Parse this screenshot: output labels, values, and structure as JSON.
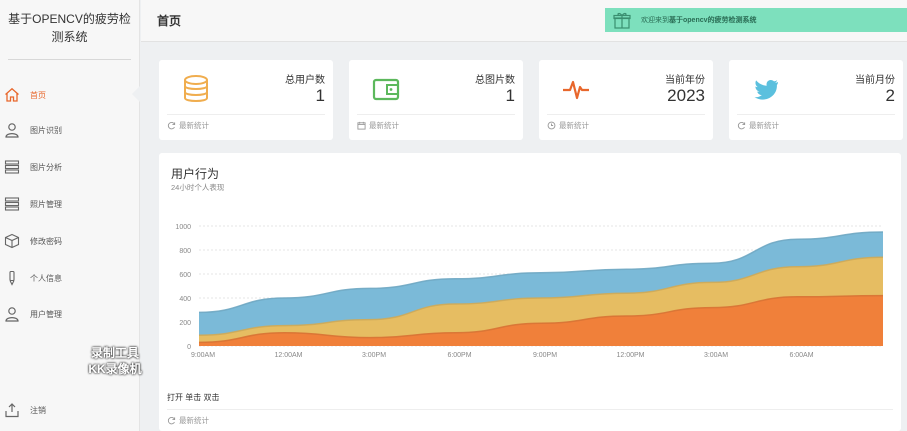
{
  "sidebar": {
    "brand": "基于OPENCV的疲劳检测系统",
    "items": [
      {
        "label": "首页",
        "icon": "home-icon",
        "active": true
      },
      {
        "label": "图片识别",
        "icon": "user-icon"
      },
      {
        "label": "图片分析",
        "icon": "list-icon"
      },
      {
        "label": "照片管理",
        "icon": "list-icon"
      },
      {
        "label": "修改密码",
        "icon": "box-icon"
      },
      {
        "label": "个人信息",
        "icon": "pen-icon"
      },
      {
        "label": "用户管理",
        "icon": "user-icon"
      },
      {
        "label": "注销",
        "icon": "logout-icon"
      }
    ]
  },
  "watermark": {
    "line1": "录制工具",
    "line2": "KK录像机"
  },
  "header": {
    "title": "首页",
    "welcome_prefix": "欢迎来到",
    "welcome_name": "基于opencv的疲劳检测系统"
  },
  "cards": [
    {
      "title": "总用户数",
      "value": "1",
      "footer": "最新统计",
      "icon": "database-icon",
      "footer_icon": "refresh-icon",
      "color": "#f0ad4e"
    },
    {
      "title": "总图片数",
      "value": "1",
      "footer": "最新统计",
      "icon": "wallet-icon",
      "footer_icon": "calendar-icon",
      "color": "#5cb85c"
    },
    {
      "title": "当前年份",
      "value": "2023",
      "footer": "最新统计",
      "icon": "pulse-icon",
      "footer_icon": "clock-icon",
      "color": "#e8672c"
    },
    {
      "title": "当前月份",
      "value": "2",
      "footer": "最新统计",
      "icon": "twitter-icon",
      "footer_icon": "refresh-icon",
      "color": "#5bc0de"
    }
  ],
  "chart": {
    "title": "用户行为",
    "subtitle": "24小时个人表现",
    "legend": "打开 单击 双击",
    "footer": "最新统计"
  },
  "chart_data": {
    "type": "area",
    "title": "用户行为",
    "subtitle": "24小时个人表现",
    "x_ticks": [
      "9:00AM",
      "12:00AM",
      "3:00PM",
      "6:00PM",
      "9:00PM",
      "12:00PM",
      "3:00AM",
      "6:00AM"
    ],
    "ylim": [
      0,
      1000
    ],
    "y_ticks": [
      0,
      200,
      400,
      600,
      800,
      1000
    ],
    "x": [
      0,
      1,
      2,
      3,
      4,
      5,
      6,
      7,
      8
    ],
    "stacked": true,
    "series": [
      {
        "name": "打开",
        "color": "#f0803a",
        "values": [
          30,
          110,
          70,
          110,
          190,
          250,
          320,
          410,
          420
        ]
      },
      {
        "name": "单击",
        "color": "#e6bd62",
        "values": [
          60,
          60,
          150,
          240,
          210,
          190,
          210,
          250,
          320
        ]
      },
      {
        "name": "双击",
        "color": "#7bbad8",
        "values": [
          190,
          230,
          260,
          210,
          210,
          200,
          160,
          230,
          210
        ]
      }
    ],
    "grid": true
  }
}
